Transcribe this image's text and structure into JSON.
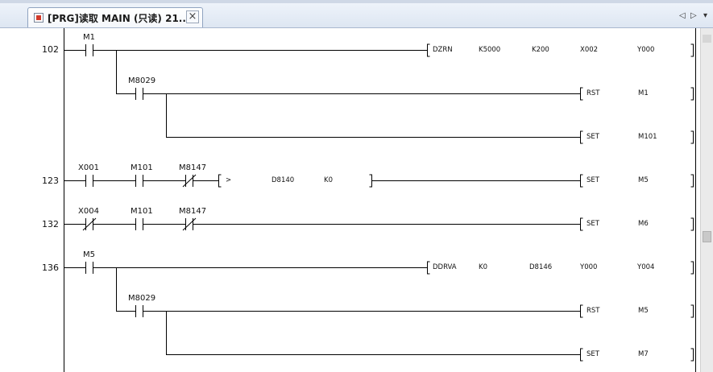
{
  "tab": {
    "title": "[PRG]读取 MAIN (只读) 21...",
    "close": "×"
  },
  "nav": {
    "left": "◁",
    "right": "▷",
    "menu": "▾"
  },
  "rungs": [
    {
      "step": "102"
    },
    {
      "step": "123"
    },
    {
      "step": "132"
    },
    {
      "step": "136"
    }
  ],
  "contacts": [
    "M1",
    "M8029",
    "X001",
    "M101",
    "M8147",
    "X004",
    "M101",
    "M8147",
    "M5",
    "M8029"
  ],
  "instructions": [
    [
      "DZRN",
      "K5000",
      "K200",
      "X002",
      "Y000"
    ],
    [
      "RST",
      "M1"
    ],
    [
      "SET",
      "M101"
    ],
    [
      ">",
      "D8140",
      "K0"
    ],
    [
      "SET",
      "M5"
    ],
    [
      "SET",
      "M6"
    ],
    [
      "DDRVA",
      "K0",
      "D8146",
      "Y000",
      "Y004"
    ],
    [
      "RST",
      "M5"
    ],
    [
      "SET",
      "M7"
    ]
  ],
  "colors": {
    "tab_bar": "#dde6f2",
    "rails": "#000000"
  }
}
